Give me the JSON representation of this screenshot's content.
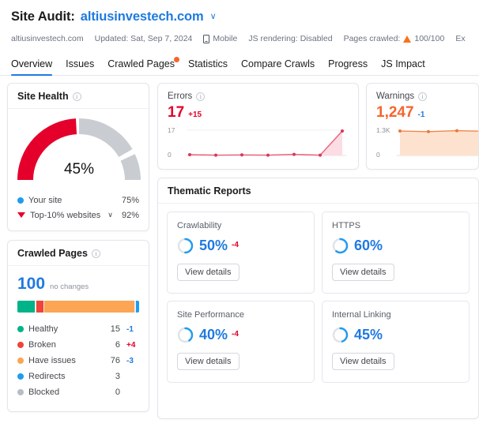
{
  "header": {
    "title_label": "Site Audit:",
    "domain": "altiusinvestech.com",
    "chevron": "∨",
    "meta": {
      "site": "altiusinvestech.com",
      "updated": "Updated: Sat, Sep 7, 2024",
      "device": "Mobile",
      "js_rendering": "JS rendering: Disabled",
      "pages_crawled_label": "Pages crawled:",
      "pages_crawled_value": "100/100",
      "export_label": "Ex"
    }
  },
  "tabs": [
    {
      "label": "Overview",
      "active": true,
      "dot": false
    },
    {
      "label": "Issues",
      "active": false,
      "dot": false
    },
    {
      "label": "Crawled Pages",
      "active": false,
      "dot": true
    },
    {
      "label": "Statistics",
      "active": false,
      "dot": false
    },
    {
      "label": "Compare Crawls",
      "active": false,
      "dot": false
    },
    {
      "label": "Progress",
      "active": false,
      "dot": false
    },
    {
      "label": "JS Impact",
      "active": false,
      "dot": false
    }
  ],
  "site_health": {
    "title": "Site Health",
    "info": "i",
    "score": "45%",
    "legend": [
      {
        "label": "Your site",
        "value": "75%",
        "marker": "dot",
        "color": "#1f9cf0"
      },
      {
        "label": "Top-10% websites",
        "value": "92%",
        "marker": "triangle",
        "color": "#e4002b",
        "chevron": "∨"
      }
    ]
  },
  "crawled_pages": {
    "title": "Crawled Pages",
    "info": "i",
    "total": "100",
    "subtitle": "no changes",
    "rows": [
      {
        "label": "Healthy",
        "count": "15",
        "delta": "-1",
        "delta_dir": "neg",
        "color": "#00b388"
      },
      {
        "label": "Broken",
        "count": "6",
        "delta": "+4",
        "delta_dir": "pos",
        "color": "#f04438"
      },
      {
        "label": "Have issues",
        "count": "76",
        "delta": "-3",
        "delta_dir": "neg",
        "color": "#fba555"
      },
      {
        "label": "Redirects",
        "count": "3",
        "delta": "",
        "delta_dir": "",
        "color": "#1f9cf0"
      },
      {
        "label": "Blocked",
        "count": "0",
        "delta": "",
        "delta_dir": "",
        "color": "#b8bec6"
      }
    ]
  },
  "errors": {
    "title": "Errors",
    "info": "i",
    "value": "17",
    "delta": "+15",
    "y_top": "17",
    "y_bottom": "0"
  },
  "warnings": {
    "title": "Warnings",
    "info": "i",
    "value": "1,247",
    "delta": "-1",
    "y_top": "1.3K",
    "y_bottom": "0"
  },
  "thematic": {
    "title": "Thematic Reports",
    "cards": [
      {
        "name": "Crawlability",
        "percent": "50%",
        "delta": "-4",
        "button": "View details"
      },
      {
        "name": "HTTPS",
        "percent": "60%",
        "delta": "",
        "button": "View details"
      },
      {
        "name": "Site Performance",
        "percent": "40%",
        "delta": "-4",
        "button": "View details"
      },
      {
        "name": "Internal Linking",
        "percent": "45%",
        "delta": "",
        "button": "View details"
      }
    ]
  },
  "chart_data": [
    {
      "type": "area",
      "title": "Errors",
      "x": [
        1,
        2,
        3,
        4,
        5,
        6,
        7
      ],
      "values": [
        0.6,
        0.4,
        0.5,
        0.4,
        0.9,
        0.4,
        17
      ],
      "ylim": [
        0,
        17
      ],
      "ytick_labels": [
        "0",
        "17"
      ],
      "line_color": "#e8607a",
      "fill_color": "#fbdde3",
      "grid": true,
      "legend": "none"
    },
    {
      "type": "area",
      "title": "Warnings",
      "x": [
        1,
        2,
        3,
        4,
        5,
        6,
        7
      ],
      "values": [
        1247,
        1246,
        1248,
        1247,
        1248,
        1247,
        1247
      ],
      "ylim": [
        0,
        1300
      ],
      "ytick_labels": [
        "0",
        "1.3K"
      ],
      "line_color": "#f0874a",
      "fill_color": "#fde3cf",
      "grid": false,
      "legend": "none"
    },
    {
      "type": "pie",
      "title": "Site Health",
      "categories": [
        "Your site",
        "Remaining"
      ],
      "values": [
        45,
        55
      ],
      "labels": [
        "45%"
      ],
      "colors": [
        "#e4002b",
        "#c9cdd2"
      ]
    },
    {
      "type": "bar",
      "title": "Crawled Pages",
      "categories": [
        "Healthy",
        "Broken",
        "Have issues",
        "Redirects",
        "Blocked"
      ],
      "values": [
        15,
        6,
        76,
        3,
        0
      ],
      "colors": [
        "#00b388",
        "#f04438",
        "#fba555",
        "#1f9cf0",
        "#b8bec6"
      ],
      "total": 100
    },
    {
      "type": "pie",
      "title": "Thematic Reports",
      "categories": [
        "Crawlability",
        "HTTPS",
        "Site Performance",
        "Internal Linking"
      ],
      "values": [
        50,
        60,
        40,
        45
      ],
      "colors": [
        "#1f7ae0",
        "#1f7ae0",
        "#1f7ae0",
        "#1f7ae0"
      ]
    }
  ]
}
